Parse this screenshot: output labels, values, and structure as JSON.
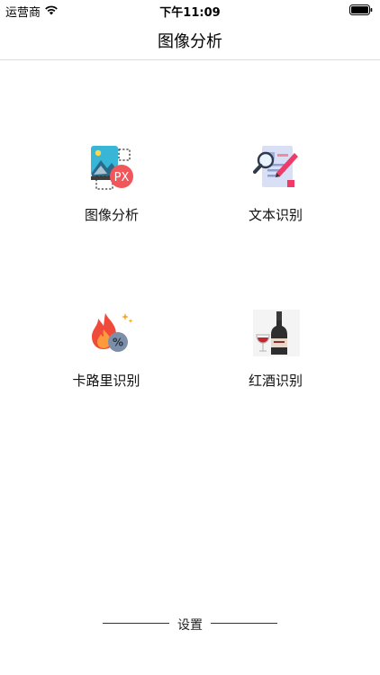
{
  "status_bar": {
    "carrier": "运营商",
    "time": "下午11:09"
  },
  "nav": {
    "title": "图像分析"
  },
  "tiles": [
    {
      "label": "图像分析",
      "icon": "image-px-icon"
    },
    {
      "label": "文本识别",
      "icon": "document-search-icon"
    },
    {
      "label": "卡路里识别",
      "icon": "calorie-flame-icon"
    },
    {
      "label": "红酒识别",
      "icon": "wine-bottle-icon"
    }
  ],
  "footer": {
    "settings_label": "设置"
  },
  "colors": {
    "accent_red": "#f0565a",
    "divider": "#dcdcdc"
  }
}
